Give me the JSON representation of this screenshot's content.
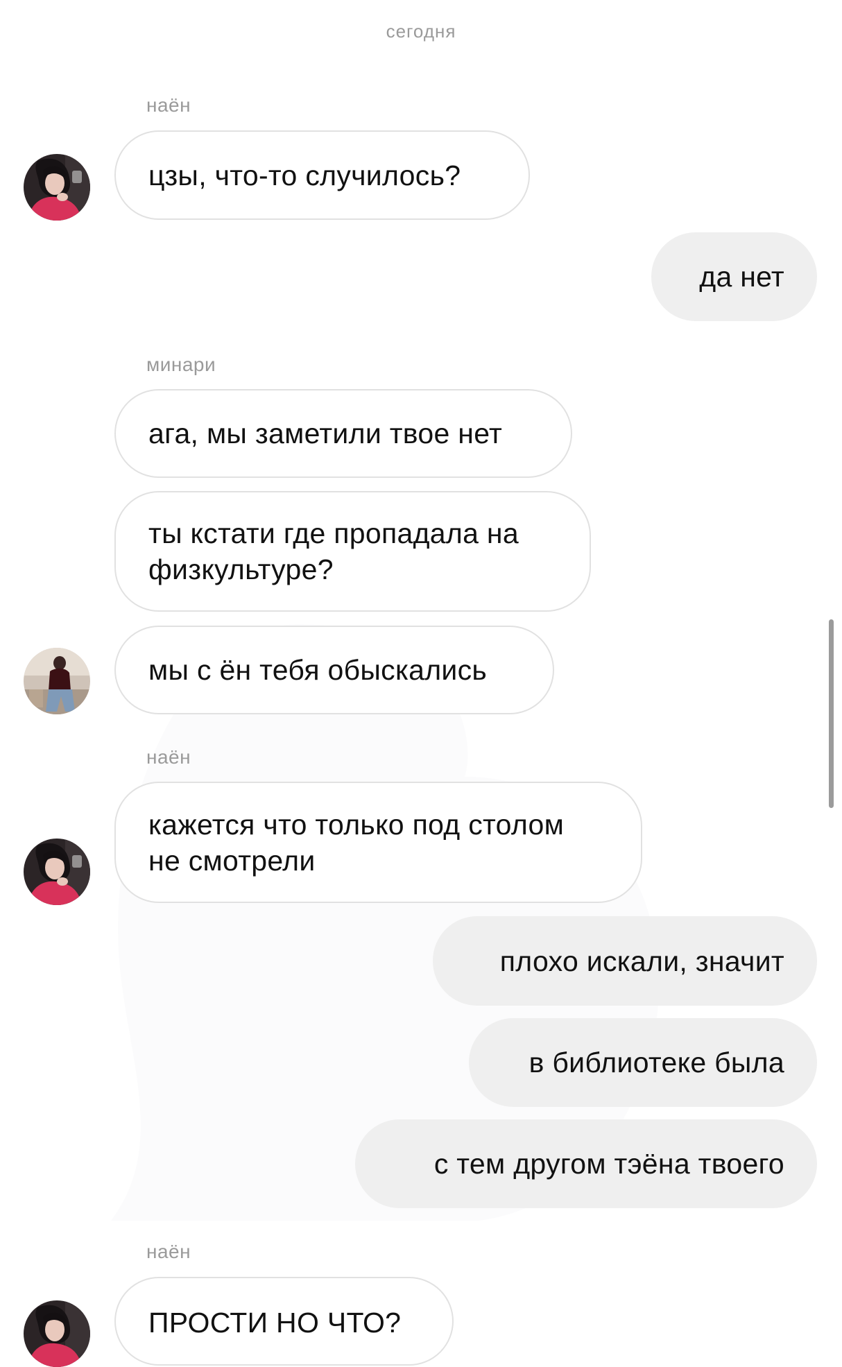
{
  "date_divider": "сегодня",
  "messages": [
    {
      "sender": "наён"
    },
    {
      "text": "цзы, что-то случилось?"
    },
    {
      "text": "да нет"
    },
    {
      "sender": "минари"
    },
    {
      "text": "ага, мы заметили твое нет"
    },
    {
      "text": "ты кстати где пропадала на\nфизкультуре?"
    },
    {
      "text": "мы с ён тебя обыскались"
    },
    {
      "sender": "наён"
    },
    {
      "text": "кажется что только под столом\nне смотрели"
    },
    {
      "text": "плохо искали, значит"
    },
    {
      "text": "в библиотеке была"
    },
    {
      "text": "с тем другом тэёна твоего"
    },
    {
      "sender": "наён"
    },
    {
      "text": "ПРОСТИ НО ЧТО?"
    }
  ],
  "avatars": {
    "nayeon_icon": "avatar-nayeon",
    "minari_icon": "avatar-minari"
  },
  "colors": {
    "incoming_border": "#e1e1e1",
    "outgoing_bg": "#efefef",
    "meta_text": "#9a9a9a",
    "scrollbar": "#9b9b9b"
  }
}
